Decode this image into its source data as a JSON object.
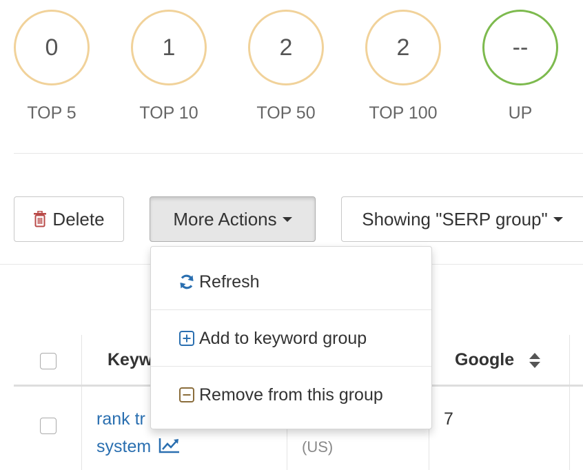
{
  "stats": [
    {
      "value": "0",
      "label": "TOP 5"
    },
    {
      "value": "1",
      "label": "TOP 10"
    },
    {
      "value": "2",
      "label": "TOP 50"
    },
    {
      "value": "2",
      "label": "TOP 100"
    },
    {
      "value": "--",
      "label": "UP"
    }
  ],
  "toolbar": {
    "delete_label": "Delete",
    "more_actions_label": "More Actions",
    "showing_label": "Showing \"SERP group\""
  },
  "menu": {
    "items": [
      {
        "label": "Refresh",
        "icon": "refresh-icon"
      },
      {
        "label": "Add to keyword group",
        "icon": "plus-square-icon"
      },
      {
        "label": "Remove from this group",
        "icon": "minus-square-icon"
      }
    ]
  },
  "table": {
    "headers": {
      "keyword": "Keyw",
      "google": "Google"
    },
    "rows": [
      {
        "keyword_line1": "rank tr",
        "keyword_line2": "system",
        "location": "(US)",
        "google": "7"
      }
    ]
  },
  "colors": {
    "circle_default": "#f1d29a",
    "circle_up": "#7dba4e",
    "link": "#2a6fb0",
    "delete_icon": "#b94a48",
    "refresh_icon": "#2a6fb0",
    "add_icon": "#2a6fb0",
    "remove_icon": "#8a6d3b"
  }
}
